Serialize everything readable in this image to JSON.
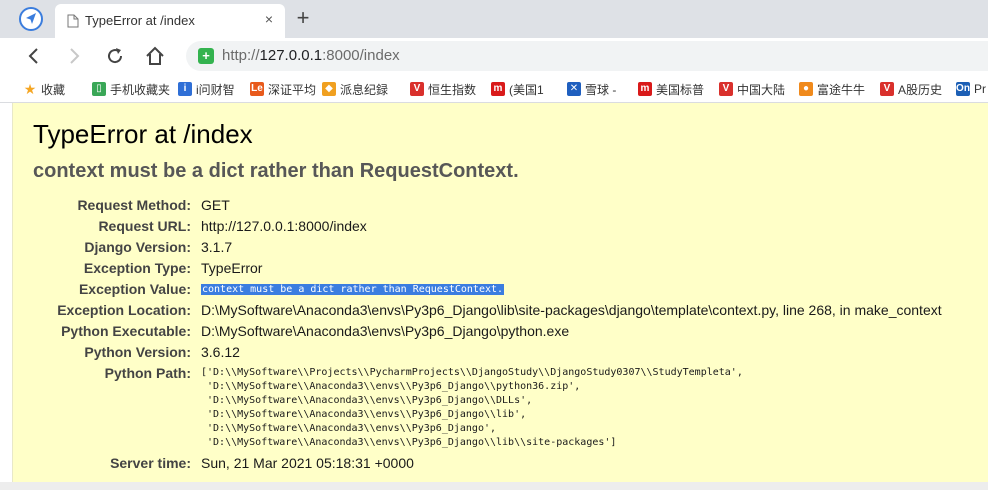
{
  "browser": {
    "tab_title": "TypeError at /index",
    "close_glyph": "×",
    "new_tab_glyph": "+",
    "url": {
      "protocol": "http://",
      "host": "127.0.0.1",
      "rest": ":8000/index"
    }
  },
  "bookmarks": [
    {
      "label": "收藏",
      "icon": "star-icon",
      "color": "#f5a623"
    },
    {
      "label": "手机收藏夹",
      "icon": "phone-icon",
      "color": "#3aa757"
    },
    {
      "label": "i问财智",
      "icon": "iwencai-icon",
      "color": "#2f6fd6"
    },
    {
      "label": "深证平均",
      "icon": "le-icon",
      "color": "#e85a1c"
    },
    {
      "label": "派息纪録",
      "icon": "paixi-icon",
      "color": "#f0a020"
    },
    {
      "label": "恒生指数",
      "icon": "v-icon",
      "color": "#d9302c"
    },
    {
      "label": "(美国1",
      "icon": "m-icon",
      "color": "#d91a1a"
    },
    {
      "label": "雪球 -",
      "icon": "xueqiu-icon",
      "color": "#1f5fbf"
    },
    {
      "label": "美国标普",
      "icon": "m-icon",
      "color": "#d91a1a"
    },
    {
      "label": "中国大陆",
      "icon": "v-icon",
      "color": "#d9302c"
    },
    {
      "label": "富途牛牛",
      "icon": "futu-icon",
      "color": "#f08a1c"
    },
    {
      "label": "A股历史",
      "icon": "v-icon",
      "color": "#d9302c"
    },
    {
      "label": "Pr",
      "icon": "on-icon",
      "color": "#1c5fb5"
    }
  ],
  "error": {
    "title": "TypeError at /index",
    "message": "context must be a dict rather than RequestContext."
  },
  "meta": [
    {
      "label": "Request Method:",
      "value": "GET"
    },
    {
      "label": "Request URL:",
      "value": "http://127.0.0.1:8000/index"
    },
    {
      "label": "Django Version:",
      "value": "3.1.7"
    },
    {
      "label": "Exception Type:",
      "value": "TypeError"
    },
    {
      "label": "Exception Value:",
      "value": "context must be a dict rather than RequestContext."
    },
    {
      "label": "Exception Location:",
      "value": "D:\\MySoftware\\Anaconda3\\envs\\Py3p6_Django\\lib\\site-packages\\django\\template\\context.py, line 268, in make_context"
    },
    {
      "label": "Python Executable:",
      "value": "D:\\MySoftware\\Anaconda3\\envs\\Py3p6_Django\\python.exe"
    },
    {
      "label": "Python Version:",
      "value": "3.6.12"
    },
    {
      "label": "Python Path:",
      "value": ""
    },
    {
      "label": "Server time:",
      "value": "Sun, 21 Mar 2021 05:18:31 +0000"
    }
  ],
  "python_path": [
    "['D:\\\\MySoftware\\\\Projects\\\\PycharmProjects\\\\DjangoStudy\\\\DjangoStudy0307\\\\StudyTempleta',",
    " 'D:\\\\MySoftware\\\\Anaconda3\\\\envs\\\\Py3p6_Django\\\\python36.zip',",
    " 'D:\\\\MySoftware\\\\Anaconda3\\\\envs\\\\Py3p6_Django\\\\DLLs',",
    " 'D:\\\\MySoftware\\\\Anaconda3\\\\envs\\\\Py3p6_Django\\\\lib',",
    " 'D:\\\\MySoftware\\\\Anaconda3\\\\envs\\\\Py3p6_Django',",
    " 'D:\\\\MySoftware\\\\Anaconda3\\\\envs\\\\Py3p6_Django\\\\lib\\\\site-packages']"
  ]
}
